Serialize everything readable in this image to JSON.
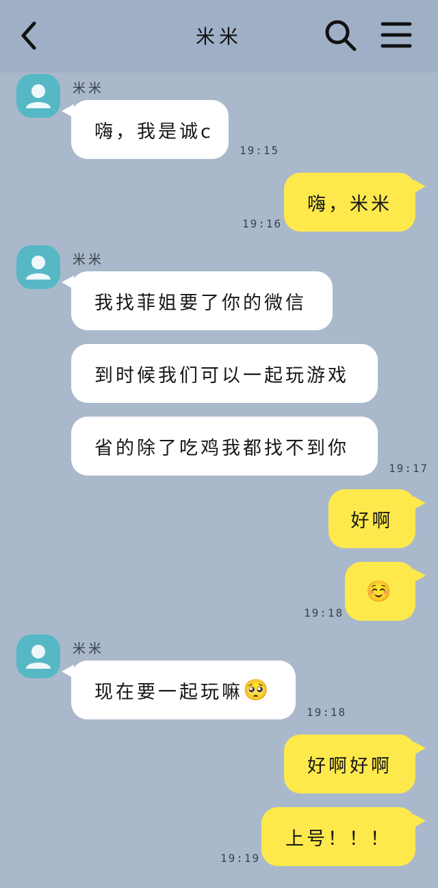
{
  "header": {
    "title": "米米"
  },
  "icons": {
    "back": "back-arrow-icon",
    "search": "search-icon",
    "menu": "menu-icon"
  },
  "colors": {
    "background": "#aab8cb",
    "header": "#9fb0c6",
    "outgoing_bubble": "#fde94b",
    "incoming_bubble": "#ffffff",
    "avatar": "#56b8c5"
  },
  "contact": {
    "name": "米米"
  },
  "messages": [
    {
      "from": "contact",
      "text": "嗨，我是诚c"
    },
    {
      "time": "19:15"
    },
    {
      "from": "me",
      "text": "嗨，米米"
    },
    {
      "time": "19:16"
    },
    {
      "from": "contact",
      "text": "我找菲姐要了你的微信"
    },
    {
      "from": "contact",
      "text": "到时候我们可以一起玩游戏"
    },
    {
      "from": "contact",
      "text": "省的除了吃鸡我都找不到你"
    },
    {
      "time": "19:17"
    },
    {
      "from": "me",
      "text": "好啊"
    },
    {
      "from": "me",
      "text": "☺️"
    },
    {
      "time": "19:18"
    },
    {
      "from": "contact",
      "text": "现在要一起玩嘛",
      "emoji": "🥺"
    },
    {
      "time": "19:18"
    },
    {
      "from": "me",
      "text": "好啊好啊"
    },
    {
      "from": "me",
      "text": "上号！！！"
    },
    {
      "time": "19:19"
    }
  ]
}
